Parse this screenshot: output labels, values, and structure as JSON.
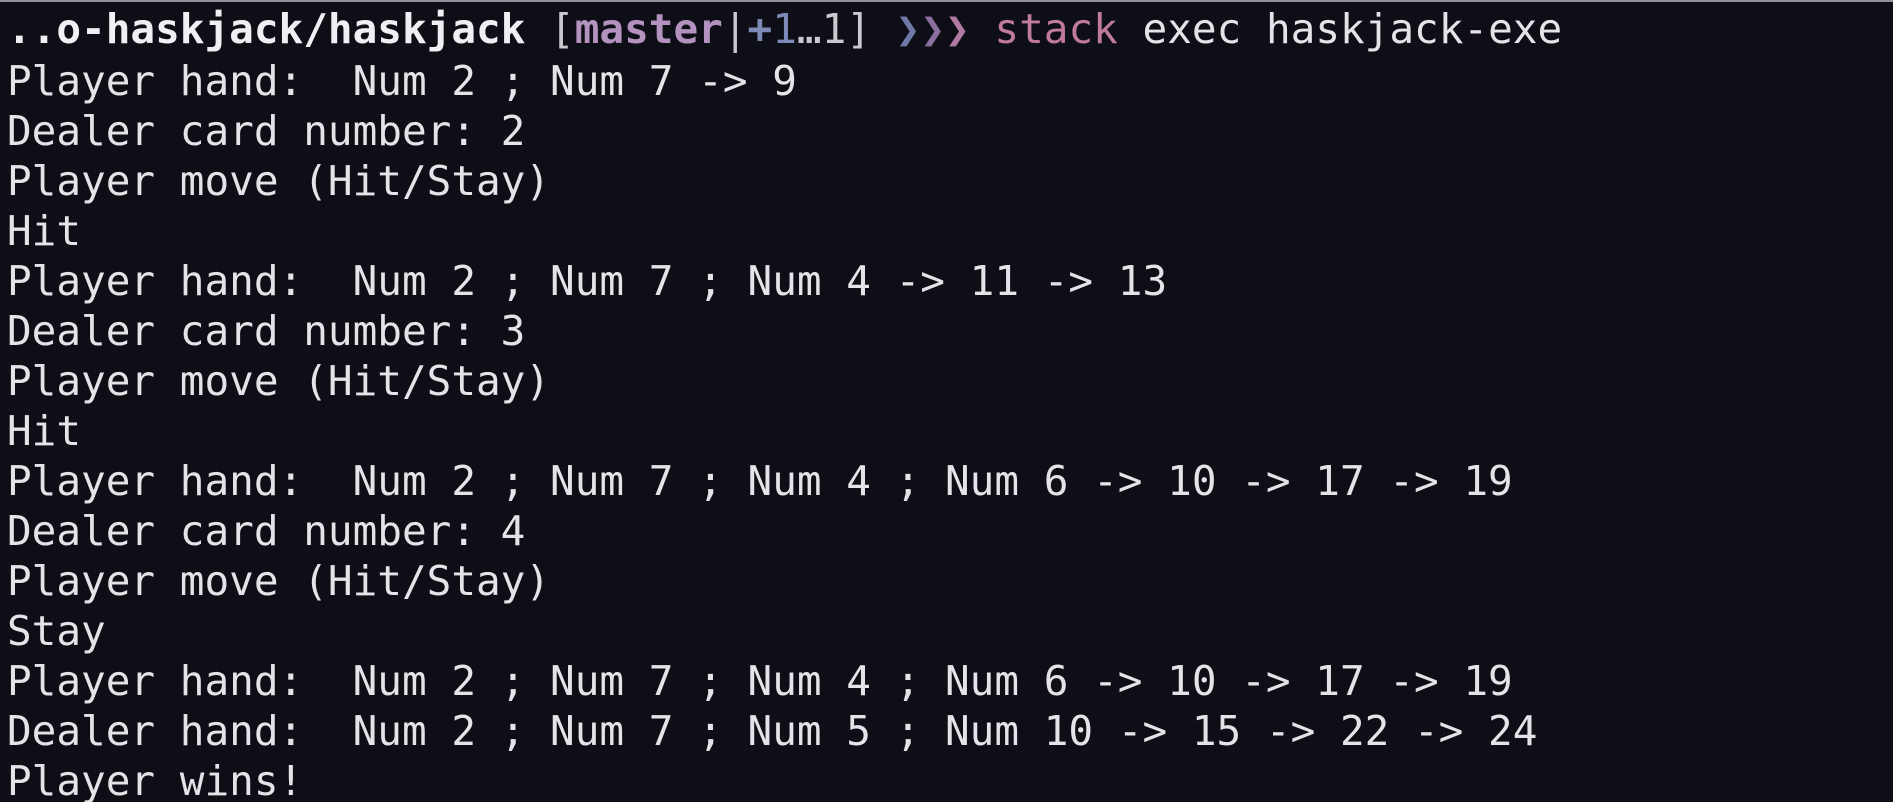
{
  "prompt": {
    "path": "..o-haskjack/haskjack",
    "open_bracket": " [",
    "branch": "master",
    "separator": "|",
    "plus_icon": "+",
    "staged_count": "1",
    "stash": "…1",
    "close_bracket": "]",
    "chevrons": [
      "❯",
      "❯",
      "❯"
    ],
    "command": "stack",
    "arguments": " exec haskjack-exe",
    "colors": {
      "background": "#0e0e16",
      "text": "#e4e4e8",
      "branch": "#b392c0",
      "command": "#c07a9c",
      "chevron_1": "#6f79a6",
      "chevron_2": "#8b6f9e",
      "chevron_3": "#b07aa3"
    }
  },
  "output": [
    "Player hand:  Num 2 ; Num 7 -> 9",
    "Dealer card number: 2",
    "Player move (Hit/Stay)",
    "Hit",
    "Player hand:  Num 2 ; Num 7 ; Num 4 -> 11 -> 13",
    "Dealer card number: 3",
    "Player move (Hit/Stay)",
    "Hit",
    "Player hand:  Num 2 ; Num 7 ; Num 4 ; Num 6 -> 10 -> 17 -> 19",
    "Dealer card number: 4",
    "Player move (Hit/Stay)",
    "Stay",
    "Player hand:  Num 2 ; Num 7 ; Num 4 ; Num 6 -> 10 -> 17 -> 19",
    "Dealer hand:  Num 2 ; Num 7 ; Num 5 ; Num 10 -> 15 -> 22 -> 24",
    "Player wins!"
  ]
}
